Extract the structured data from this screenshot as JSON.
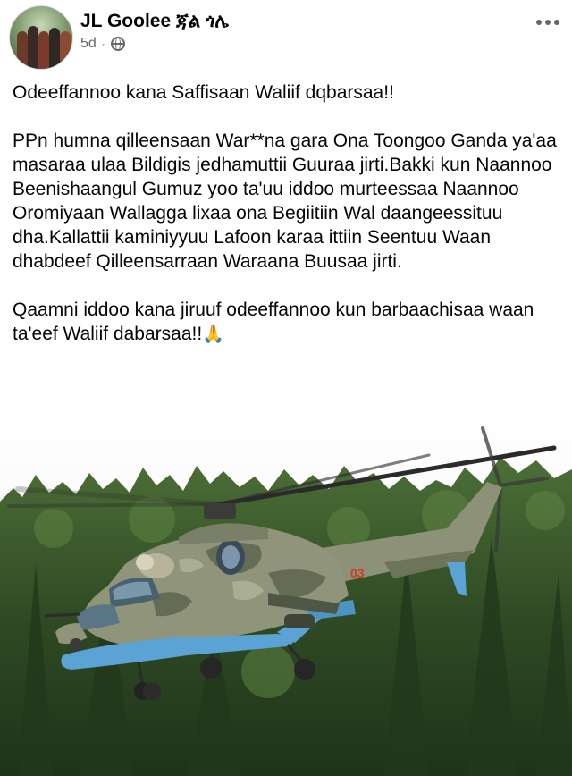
{
  "post": {
    "author_name": "JL Goolee ጃል ጎሌ",
    "timestamp": "5d",
    "separator": "·",
    "visibility_icon": "globe-icon",
    "more_icon": "more-options-icon",
    "paragraphs": [
      "Odeeffannoo kana Saffisaan Waliif dqbarsaa!!",
      "PPn humna qilleensaan War**na gara Ona Toongoo Ganda ya'aa masaraa ulaa Bildigis jedhamuttii Guuraa jirti.Bakki kun Naannoo Beenishaangul Gumuz yoo ta'uu iddoo murteessaa Naannoo Oromiyaan Wallagga lixaa ona Begiitiin Wal daangeessituu dha.Kallattii kaminiyyuu Lafoon karaa ittiin Seentuu Waan dhabdeef Qilleensarraan Waraana Buusaa jirti."
    ],
    "last_paragraph": "Qaamni iddoo kana jiruuf odeeffannoo kun barbaachisaa waan ta'eef Waliif dabarsaa!!",
    "emoji": "🙏",
    "photo": {
      "subject": "military helicopter over forest",
      "tail_number": "03"
    }
  },
  "colors": {
    "text": "#050505",
    "meta": "#65676b",
    "sky": "#f4f5f6",
    "forest": "#3f5f2e",
    "helicopter_camo": "#8f947a",
    "helicopter_belly": "#5ba3d4"
  }
}
